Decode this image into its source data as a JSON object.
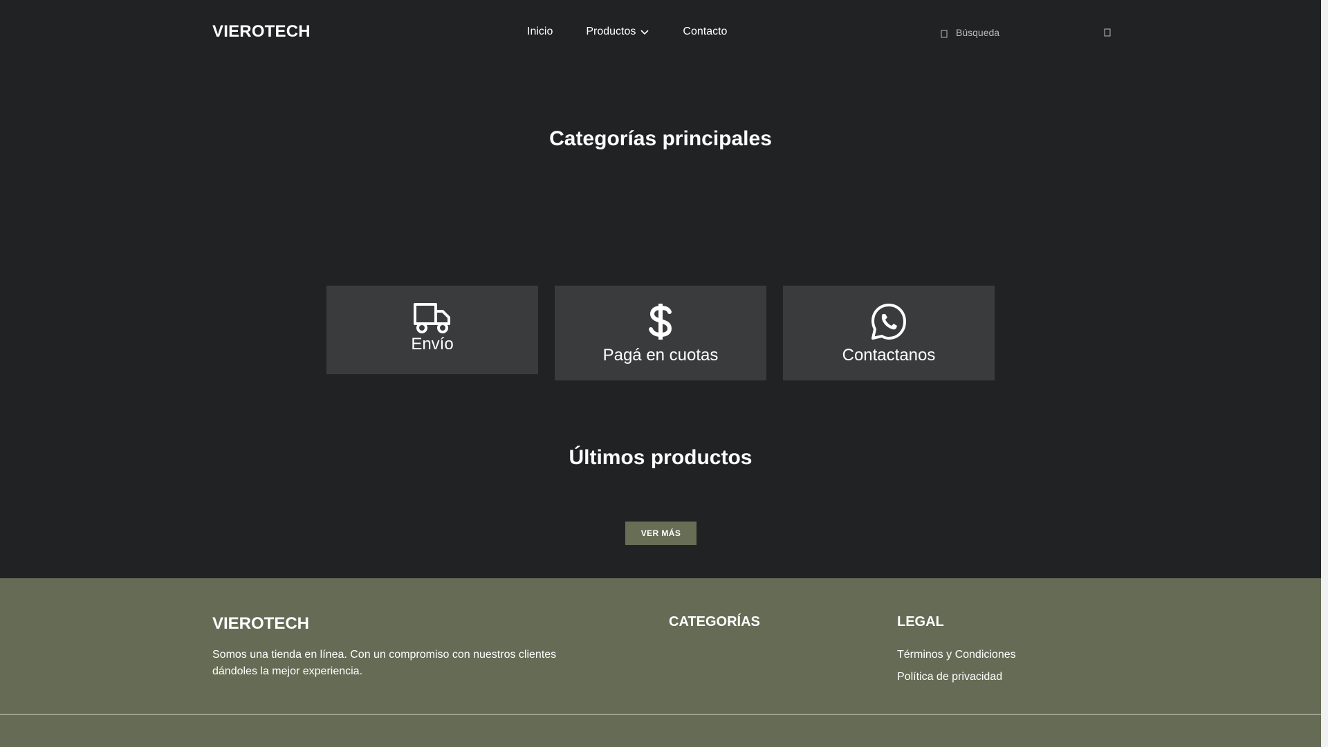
{
  "header": {
    "brand": "VIEROTECH",
    "nav": [
      {
        "label": "Inicio"
      },
      {
        "label": "Productos"
      },
      {
        "label": "Contacto"
      }
    ],
    "search": {
      "placeholder": "Búsqueda",
      "icon": "search-icon"
    }
  },
  "sections": {
    "categories_title": "Categorías principales",
    "latest_title": "Últimos productos",
    "see_more_label": "VER MÁS"
  },
  "features": [
    {
      "label": "Envío",
      "icon": "truck-icon"
    },
    {
      "label": "Pagá en cuotas",
      "icon": "dollar-icon"
    },
    {
      "label": "Contactanos",
      "icon": "whatsapp-icon"
    }
  ],
  "footer": {
    "brand": "VIEROTECH",
    "about": "Somos una tienda en línea. Con un compromiso con nuestros clientes dándoles la mejor experiencia.",
    "categories_title": "CATEGORÍAS",
    "legal_title": "LEGAL",
    "legal_links": [
      {
        "label": "Términos y Condiciones"
      },
      {
        "label": "Política de privacidad"
      }
    ]
  },
  "colors": {
    "background": "#212223",
    "card": "#3a3b3d",
    "accent": "#686d56",
    "footer": "#666b55"
  }
}
